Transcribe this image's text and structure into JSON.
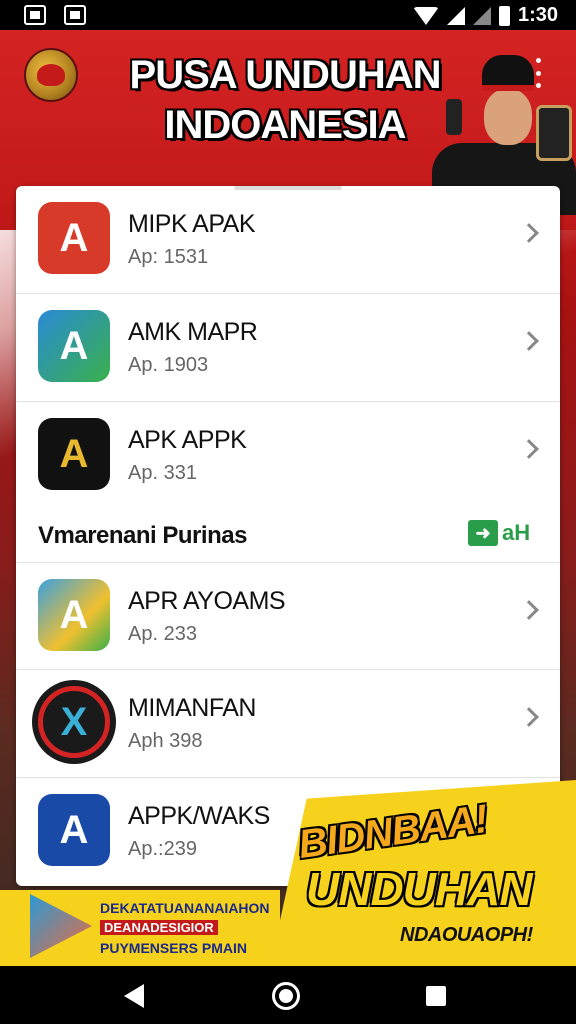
{
  "status_bar": {
    "time": "1:30"
  },
  "header": {
    "title_line1": "PUSA UNDUHAN",
    "title_line2": "INDOANESIA"
  },
  "apps_top": [
    {
      "name": "MIPK APAK",
      "version": "Ap: 1531",
      "icon_letter": "A",
      "icon_color": "#d83a2a",
      "icon": "app-a-red-icon"
    },
    {
      "name": "AMK MAPR",
      "version": "Ap. 1903",
      "icon_letter": "A",
      "icon_color": "#2a8ad6",
      "icon": "app-a-blue-green-icon"
    },
    {
      "name": "APK APPK",
      "version": "Ap. 331",
      "icon_letter": "A",
      "icon_color": "#111111",
      "icon": "app-a-black-gold-icon"
    }
  ],
  "section": {
    "title": "Vmarenani Purinas",
    "badge_text": "aH"
  },
  "apps_bottom": [
    {
      "name": "APR AYOAMS",
      "version": "Ap. 233",
      "icon_letter": "A",
      "icon_color": "#3aa0e0",
      "icon": "app-a-colorful-icon"
    },
    {
      "name": "MIMANFAN",
      "version": "Aph 398",
      "icon_letter": "X",
      "icon_color": "#1a1a1a",
      "icon": "app-x-red-circle-icon"
    },
    {
      "name": "APPK/WAKS",
      "version": "Ap.:239",
      "icon_letter": "A",
      "icon_color": "#1a4aa8",
      "icon": "app-a-blue-icon"
    }
  ],
  "promo": {
    "line1": "BIDNBAA!",
    "line2": "UNDUHAN",
    "line3": "NDAOUAOPH!"
  },
  "ad": {
    "line1": "DEKATATUANANAIAHON",
    "line2": "DEANADESIGIOR",
    "line3": "PUYMENSERS PMAIN"
  },
  "colors": {
    "header_red": "#d42323",
    "promo_yellow": "#f6d21c",
    "badge_green": "#2a9d4a"
  }
}
